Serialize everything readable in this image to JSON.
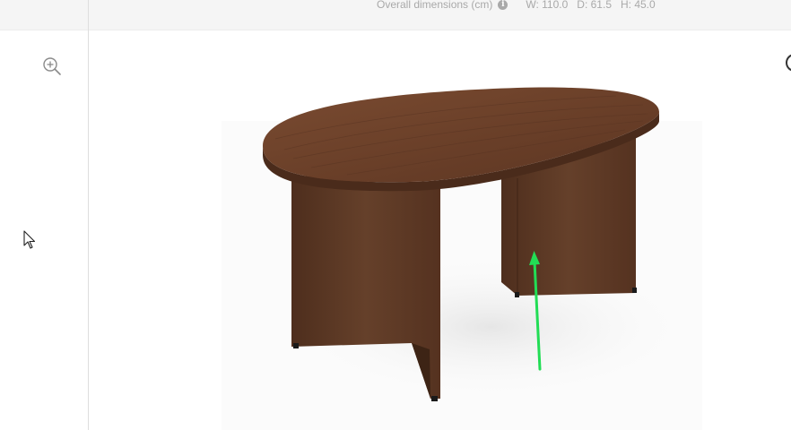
{
  "header": {
    "dimensions_label": "Overall dimensions (cm)",
    "info_icon": "info-icon",
    "width": "W: 110.0",
    "depth": "D: 61.5",
    "height": "H: 45.0"
  },
  "toolbar": {
    "zoom_icon": "zoom-in-icon"
  },
  "product_image": {
    "subject": "walnut-oval-table",
    "annotation_icon": "green-arrow-icon"
  },
  "colors": {
    "topbar_bg": "#f5f5f5",
    "wood_dark": "#5a3523",
    "wood_mid": "#6e432b",
    "arrow": "#22dd55"
  }
}
